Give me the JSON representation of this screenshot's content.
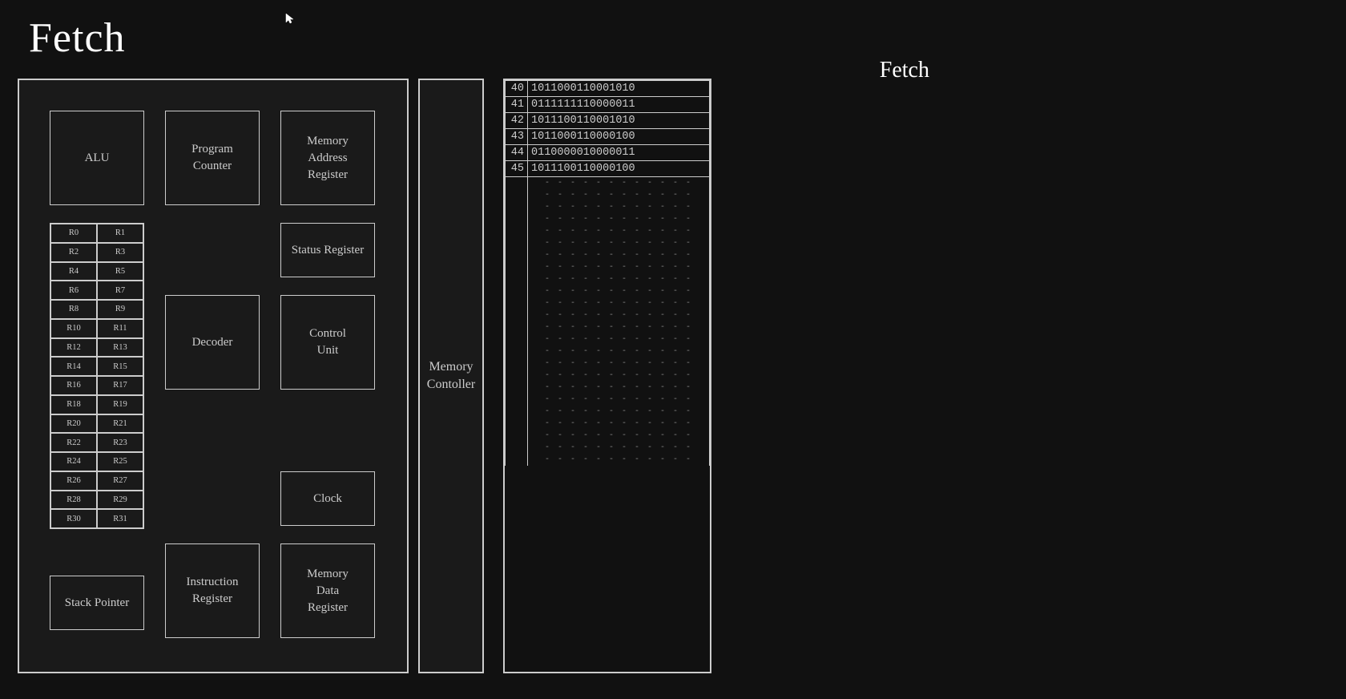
{
  "page": {
    "title": "Fetch",
    "sidebar_title": "Fetch"
  },
  "cpu": {
    "alu_label": "ALU",
    "pc_label": "Program\nCounter",
    "mar_label": "Memory\nAddress\nRegister",
    "status_label": "Status Register",
    "decoder_label": "Decoder",
    "cu_label": "Control\nUnit",
    "clock_label": "Clock",
    "ir_label": "Instruction\nRegister",
    "mdr_label": "Memory\nData\nRegister",
    "sp_label": "Stack Pointer",
    "registers": [
      "R0",
      "R1",
      "R2",
      "R3",
      "R4",
      "R5",
      "R6",
      "R7",
      "R8",
      "R9",
      "R10",
      "R11",
      "R12",
      "R13",
      "R14",
      "R15",
      "R16",
      "R17",
      "R18",
      "R19",
      "R20",
      "R21",
      "R22",
      "R23",
      "R24",
      "R25",
      "R26",
      "R27",
      "R28",
      "R29",
      "R30",
      "R31"
    ]
  },
  "memory_controller": {
    "label": "Memory\nContoller"
  },
  "memory": {
    "rows": [
      {
        "addr": "40",
        "data": "1011000110001010"
      },
      {
        "addr": "41",
        "data": "0111111110000011"
      },
      {
        "addr": "42",
        "data": "1011100110001010"
      },
      {
        "addr": "43",
        "data": "1011000110000100"
      },
      {
        "addr": "44",
        "data": "0110000010000011"
      },
      {
        "addr": "45",
        "data": "1011100110000100"
      }
    ],
    "dashed_rows": 24
  }
}
